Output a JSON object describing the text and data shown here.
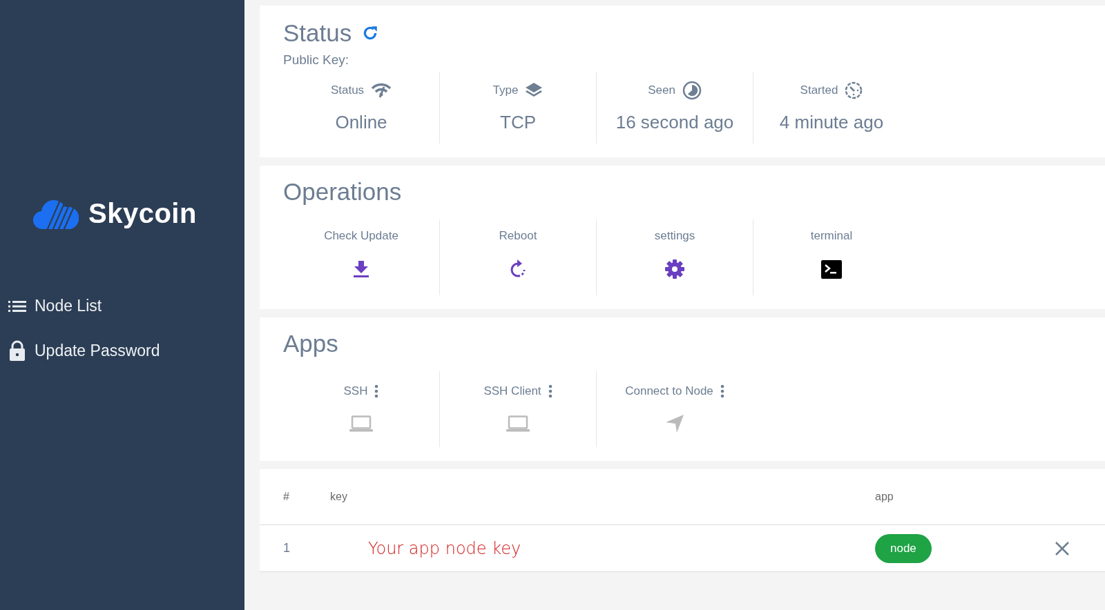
{
  "sidebar": {
    "logo_text": "Skycoin",
    "items": [
      {
        "label": "Node List",
        "kind": "list"
      },
      {
        "label": "Update Password",
        "kind": "lock"
      }
    ]
  },
  "status": {
    "title": "Status",
    "public_key_label": "Public Key:",
    "stats": [
      {
        "label": "Status",
        "kind": "signal",
        "value": "Online"
      },
      {
        "label": "Type",
        "kind": "layers",
        "value": "TCP"
      },
      {
        "label": "Seen",
        "kind": "clock",
        "value": "16 second ago"
      },
      {
        "label": "Started",
        "kind": "timer",
        "value": "4 minute ago"
      }
    ]
  },
  "operations": {
    "title": "Operations",
    "items": [
      {
        "label": "Check Update",
        "kind": "download"
      },
      {
        "label": "Reboot",
        "kind": "reboot"
      },
      {
        "label": "settings",
        "kind": "gear"
      },
      {
        "label": "terminal",
        "kind": "terminal"
      }
    ]
  },
  "apps": {
    "title": "Apps",
    "items": [
      {
        "label": "SSH",
        "kind": "laptop"
      },
      {
        "label": "SSH Client",
        "kind": "laptop"
      },
      {
        "label": "Connect to Node",
        "kind": "send"
      }
    ]
  },
  "table": {
    "columns": [
      "#",
      "key",
      "app"
    ],
    "rows": [
      {
        "index": "1",
        "key": "Your app node key",
        "app": "node"
      }
    ]
  }
}
